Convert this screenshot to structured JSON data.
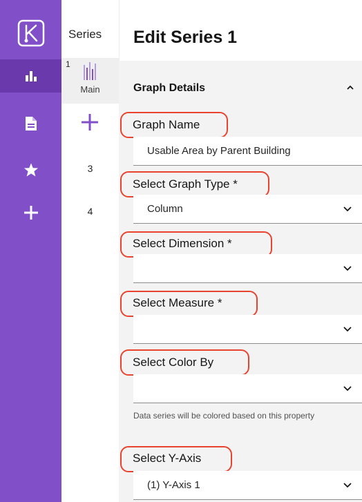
{
  "nav": {
    "items": [
      {
        "icon": "bar-chart-icon",
        "active": true
      },
      {
        "icon": "document-icon",
        "active": false
      },
      {
        "icon": "star-icon",
        "active": false
      },
      {
        "icon": "plus-icon",
        "active": false
      }
    ],
    "accent": "#8150c8",
    "active_bg": "#6a3aad"
  },
  "series_panel": {
    "title": "Series",
    "items": [
      {
        "number": "1",
        "label": "Main"
      },
      {
        "number": "3"
      },
      {
        "number": "4"
      }
    ]
  },
  "editor": {
    "title": "Edit Series 1",
    "section_title": "Graph Details",
    "fields": {
      "graph_name": {
        "label": "Graph Name",
        "value": "Usable Area by Parent Building"
      },
      "graph_type": {
        "label": "Select Graph Type *",
        "value": "Column"
      },
      "dimension": {
        "label": "Select Dimension  *",
        "value": ""
      },
      "measure": {
        "label": "Select Measure  *",
        "value": ""
      },
      "color_by": {
        "label": "Select Color By",
        "value": "",
        "helper": "Data series will be colored based on this property"
      },
      "y_axis": {
        "label": "Select Y-Axis",
        "value": "(1) Y-Axis 1"
      }
    },
    "highlight_color": "#e8432f"
  }
}
